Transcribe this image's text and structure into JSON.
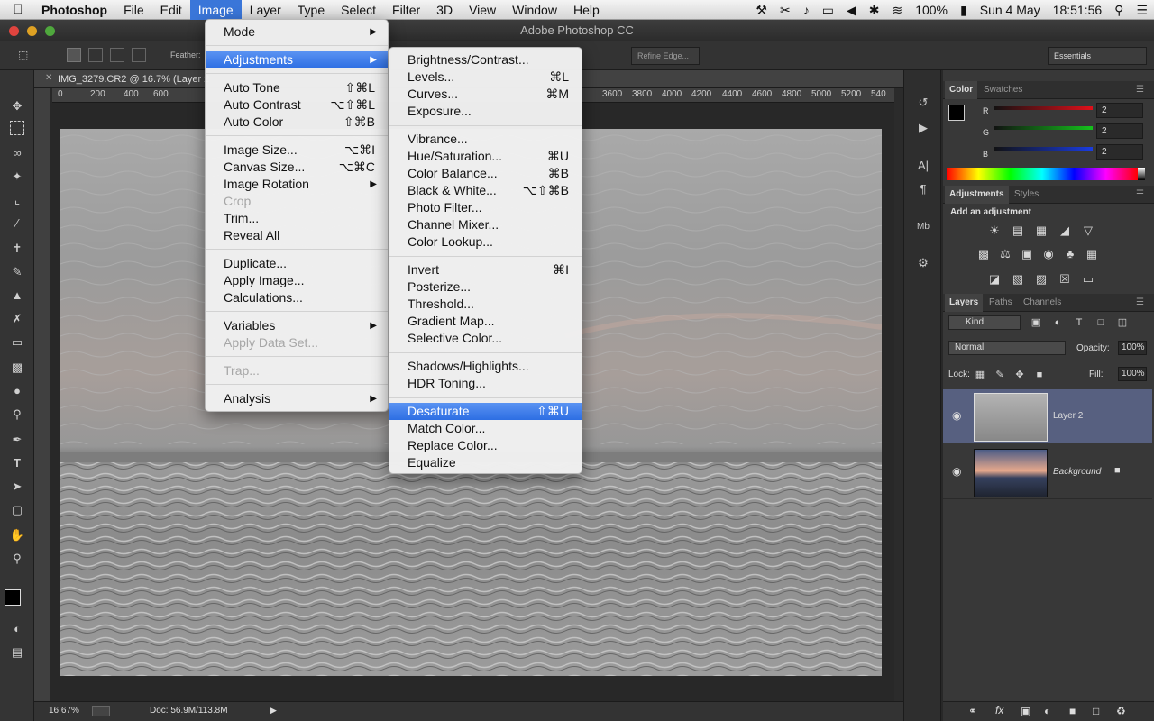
{
  "menubar": {
    "app": "Photoshop",
    "items": [
      "File",
      "Edit",
      "Image",
      "Layer",
      "Type",
      "Select",
      "Filter",
      "3D",
      "View",
      "Window",
      "Help"
    ],
    "active": "Image",
    "battery": "100%",
    "date": "Sun 4 May",
    "time": "18:51:56"
  },
  "window": {
    "title": "Adobe Photoshop CC"
  },
  "options": {
    "feather_label": "Feather:",
    "refine_edge": "Refine Edge...",
    "workspace": "Essentials"
  },
  "document": {
    "tab_title": "IMG_3279.CR2 @ 16.7% (Layer 2",
    "ruler_ticks": [
      "0",
      "200",
      "400",
      "600",
      "3600",
      "3800",
      "4000",
      "4200",
      "4400",
      "4600",
      "4800",
      "5000",
      "5200",
      "540"
    ],
    "zoom": "16.67%",
    "doc_size": "Doc: 56.9M/113.8M"
  },
  "image_menu": {
    "groups": [
      [
        {
          "label": "Mode",
          "arrow": true
        }
      ],
      [
        {
          "label": "Adjustments",
          "arrow": true,
          "highlighted": true
        }
      ],
      [
        {
          "label": "Auto Tone",
          "shortcut": "⇧⌘L"
        },
        {
          "label": "Auto Contrast",
          "shortcut": "⌥⇧⌘L"
        },
        {
          "label": "Auto Color",
          "shortcut": "⇧⌘B"
        }
      ],
      [
        {
          "label": "Image Size...",
          "shortcut": "⌥⌘I"
        },
        {
          "label": "Canvas Size...",
          "shortcut": "⌥⌘C"
        },
        {
          "label": "Image Rotation",
          "arrow": true
        },
        {
          "label": "Crop",
          "disabled": true
        },
        {
          "label": "Trim..."
        },
        {
          "label": "Reveal All"
        }
      ],
      [
        {
          "label": "Duplicate..."
        },
        {
          "label": "Apply Image..."
        },
        {
          "label": "Calculations..."
        }
      ],
      [
        {
          "label": "Variables",
          "arrow": true
        },
        {
          "label": "Apply Data Set...",
          "disabled": true
        }
      ],
      [
        {
          "label": "Trap...",
          "disabled": true
        }
      ],
      [
        {
          "label": "Analysis",
          "arrow": true
        }
      ]
    ]
  },
  "adjustments_menu": {
    "groups": [
      [
        {
          "label": "Brightness/Contrast..."
        },
        {
          "label": "Levels...",
          "shortcut": "⌘L"
        },
        {
          "label": "Curves...",
          "shortcut": "⌘M"
        },
        {
          "label": "Exposure..."
        }
      ],
      [
        {
          "label": "Vibrance..."
        },
        {
          "label": "Hue/Saturation...",
          "shortcut": "⌘U"
        },
        {
          "label": "Color Balance...",
          "shortcut": "⌘B"
        },
        {
          "label": "Black & White...",
          "shortcut": "⌥⇧⌘B"
        },
        {
          "label": "Photo Filter..."
        },
        {
          "label": "Channel Mixer..."
        },
        {
          "label": "Color Lookup..."
        }
      ],
      [
        {
          "label": "Invert",
          "shortcut": "⌘I"
        },
        {
          "label": "Posterize..."
        },
        {
          "label": "Threshold..."
        },
        {
          "label": "Gradient Map..."
        },
        {
          "label": "Selective Color..."
        }
      ],
      [
        {
          "label": "Shadows/Highlights..."
        },
        {
          "label": "HDR Toning..."
        }
      ],
      [
        {
          "label": "Desaturate",
          "shortcut": "⇧⌘U",
          "highlighted": true
        },
        {
          "label": "Match Color..."
        },
        {
          "label": "Replace Color..."
        },
        {
          "label": "Equalize"
        }
      ]
    ]
  },
  "color_panel": {
    "tabs": [
      "Color",
      "Swatches"
    ],
    "channels": [
      {
        "name": "R",
        "value": "2"
      },
      {
        "name": "G",
        "value": "2"
      },
      {
        "name": "B",
        "value": "2"
      }
    ],
    "colors": {
      "r": "#e0101a",
      "g": "#15c11c",
      "b": "#1a3ce0"
    }
  },
  "adjustments_panel": {
    "tabs": [
      "Adjustments",
      "Styles"
    ],
    "heading": "Add an adjustment"
  },
  "layers_panel": {
    "tabs": [
      "Layers",
      "Paths",
      "Channels"
    ],
    "kind": "Kind",
    "blend_mode": "Normal",
    "opacity_label": "Opacity:",
    "opacity": "100%",
    "lock_label": "Lock:",
    "fill_label": "Fill:",
    "fill": "100%",
    "layers": [
      {
        "name": "Layer 2",
        "selected": true
      },
      {
        "name": "Background",
        "locked": true
      }
    ]
  }
}
